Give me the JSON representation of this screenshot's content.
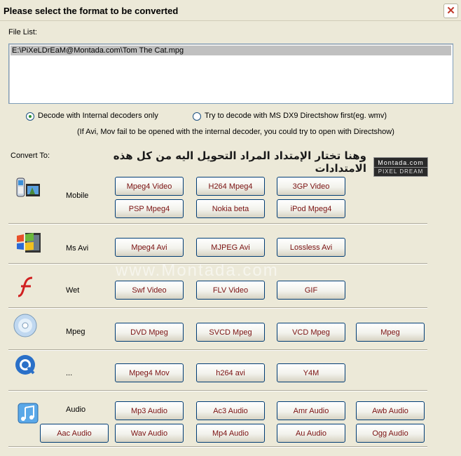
{
  "window": {
    "title": "Please select the format to be converted"
  },
  "file_list": {
    "label": "File List:",
    "items": [
      "E:\\PiXeLDrEaM@Montada.com\\Tom The Cat.mpg"
    ]
  },
  "decode_options": {
    "internal": "Decode with Internal decoders only",
    "directshow": "Try to decode with MS DX9 Directshow first(eg. wmv)",
    "note": "(If Avi, Mov fail to be opened with the internal decoder, you could try to open with Directshow)"
  },
  "convert_to": {
    "label": "Convert To:",
    "arabic_caption": "وهنا تختار الإمتداد المراد التحويل اليه من كل هذه الامتدادات",
    "logo": {
      "line1": "Montada.com",
      "line2": "PIXEL DREAM"
    }
  },
  "watermark": "www.Montada.com",
  "categories": [
    {
      "name": "Mobile",
      "icon": "mobile-icon",
      "buttons": [
        "Mpeg4 Video",
        "H264 Mpeg4",
        "3GP Video",
        "PSP Mpeg4",
        "Nokia beta",
        "iPod Mpeg4"
      ]
    },
    {
      "name": "Ms Avi",
      "icon": "windows-icon",
      "buttons": [
        "Mpeg4 Avi",
        "MJPEG Avi",
        "Lossless Avi"
      ]
    },
    {
      "name": "Wet",
      "icon": "flash-icon",
      "buttons": [
        "Swf Video",
        "FLV Video",
        "GIF"
      ]
    },
    {
      "name": "Mpeg",
      "icon": "disc-icon",
      "buttons": [
        "DVD Mpeg",
        "SVCD Mpeg",
        "VCD Mpeg",
        "Mpeg"
      ]
    },
    {
      "name": "...",
      "icon": "quicktime-icon",
      "buttons": [
        "Mpeg4 Mov",
        "h264 avi",
        "Y4M"
      ]
    },
    {
      "name": "Audio",
      "icon": "music-icon",
      "buttons": [
        "Mp3 Audio",
        "Ac3 Audio",
        "Amr Audio",
        "Awb Audio",
        "Aac Audio",
        "Wav Audio",
        "Mp4 Audio",
        "Au Audio",
        "Ogg Audio"
      ]
    }
  ],
  "colors": {
    "button_text": "#7a1010",
    "button_border": "#003c74",
    "background": "#ece9d8"
  }
}
